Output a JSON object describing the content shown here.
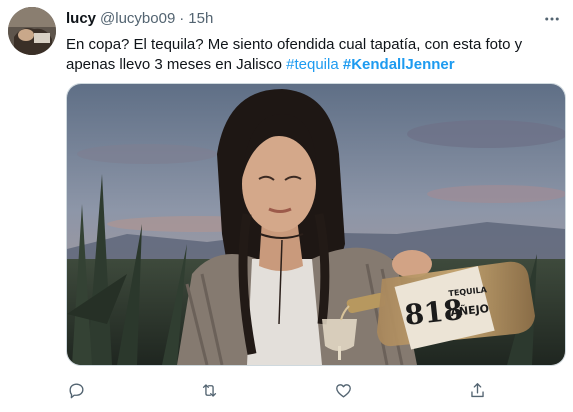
{
  "tweet": {
    "author": {
      "name": "lucy",
      "handle": "@lucybo09",
      "separator": "·",
      "time": "15h"
    },
    "text": {
      "body": "En copa? El tequila? Me siento ofendida cual tapatía, con esta foto y apenas llevo 3 meses en Jalisco",
      "hashtag_1": "#tequila",
      "hashtag_2": "#KendallJenner"
    },
    "media": {
      "bottle_label_number": "818",
      "bottle_label_line1": "TEQUILA",
      "bottle_label_line2": "AÑEJO"
    },
    "actions": {
      "reply_icon": "comment-icon",
      "retweet_icon": "retweet-icon",
      "like_icon": "heart-icon",
      "share_icon": "share-icon"
    },
    "colors": {
      "text": "#0f1419",
      "secondary": "#536471",
      "link": "#1d9bf0",
      "border": "#cfd9de"
    }
  }
}
